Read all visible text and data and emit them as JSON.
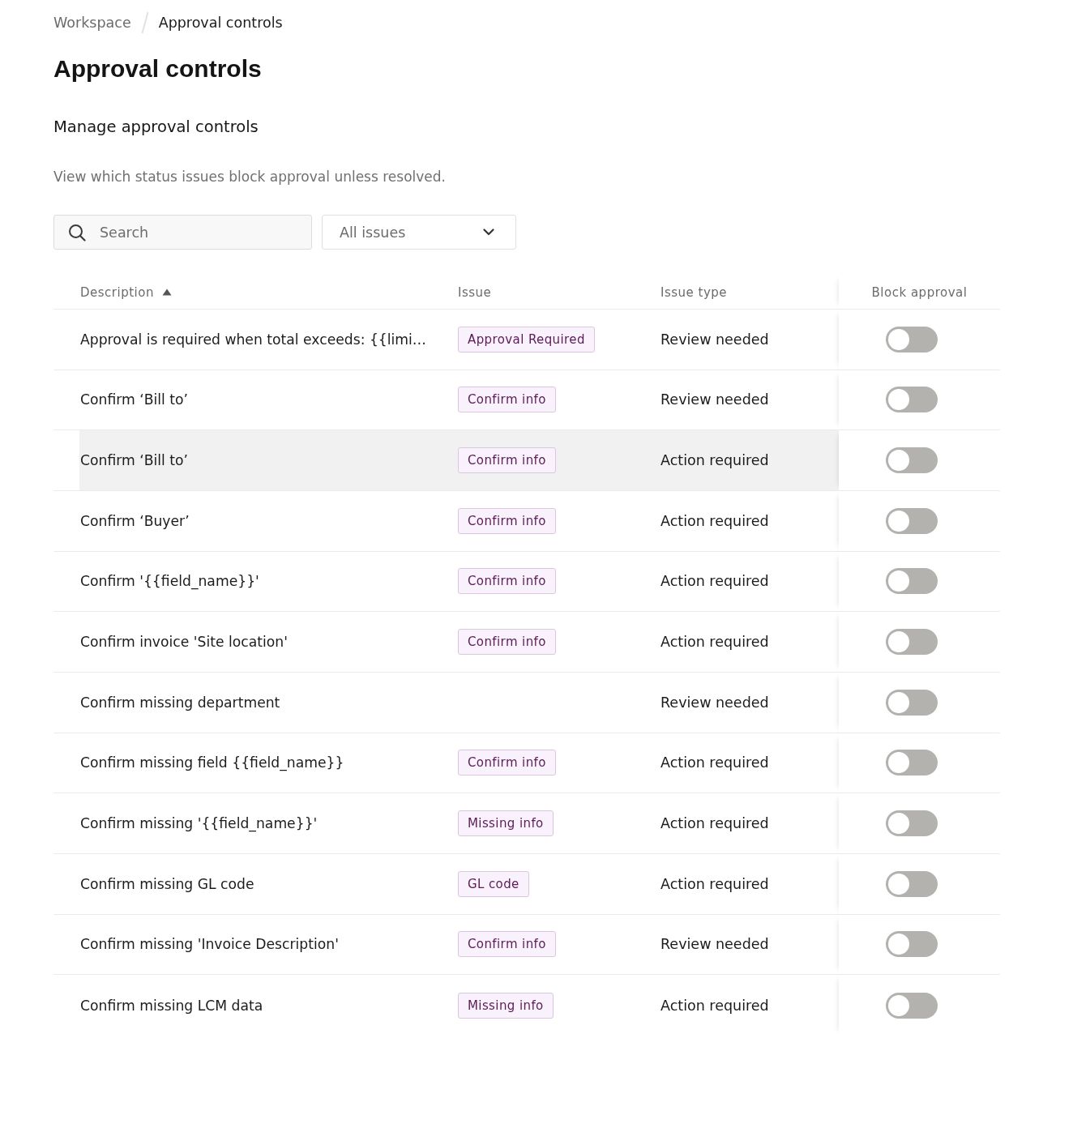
{
  "breadcrumb": [
    {
      "label": "Workspace",
      "current": false
    },
    {
      "label": "Approval controls",
      "current": true
    }
  ],
  "page_title": "Approval controls",
  "section": {
    "title": "Manage approval controls",
    "description": "View which status issues block approval unless resolved."
  },
  "filters": {
    "search": {
      "placeholder": "Search"
    },
    "issue_filter": {
      "value": "All issues"
    }
  },
  "table": {
    "columns": [
      {
        "label": "Description",
        "sorted": true
      },
      {
        "label": "Issue",
        "sorted": false
      },
      {
        "label": "Issue type",
        "sorted": false
      },
      {
        "label": "Block approval",
        "sorted": false
      }
    ],
    "rows": [
      {
        "description": "Approval is required when total exceeds: {{limi…",
        "issue": "Approval Required",
        "issue_type": "Review needed",
        "block_approval": false,
        "highlighted": false
      },
      {
        "description": "Confirm ‘Bill to’",
        "issue": "Confirm info",
        "issue_type": "Review needed",
        "block_approval": false,
        "highlighted": false
      },
      {
        "description": "Confirm ‘Bill to’",
        "issue": "Confirm info",
        "issue_type": "Action required",
        "block_approval": false,
        "highlighted": true
      },
      {
        "description": "Confirm ‘Buyer’",
        "issue": "Confirm info",
        "issue_type": "Action required",
        "block_approval": false,
        "highlighted": false
      },
      {
        "description": "Confirm '{{field_name}}'",
        "issue": "Confirm info",
        "issue_type": "Action required",
        "block_approval": false,
        "highlighted": false
      },
      {
        "description": "Confirm invoice 'Site location'",
        "issue": "Confirm info",
        "issue_type": "Action required",
        "block_approval": false,
        "highlighted": false
      },
      {
        "description": "Confirm missing department",
        "issue_type": "Review needed",
        "block_approval": false,
        "highlighted": false
      },
      {
        "description": "Confirm missing field {{field_name}}",
        "issue": "Confirm info",
        "issue_type": "Action required",
        "block_approval": false,
        "highlighted": false
      },
      {
        "description": "Confirm missing '{{field_name}}'",
        "issue": "Missing info",
        "issue_type": "Action required",
        "block_approval": false,
        "highlighted": false
      },
      {
        "description": "Confirm missing GL code",
        "issue": "GL code",
        "issue_type": "Action required",
        "block_approval": false,
        "highlighted": false
      },
      {
        "description": "Confirm missing 'Invoice Description'",
        "issue": "Confirm info",
        "issue_type": "Review needed",
        "block_approval": false,
        "highlighted": false
      },
      {
        "description": "Confirm missing LCM data",
        "issue": "Missing info",
        "issue_type": "Action required",
        "block_approval": false,
        "highlighted": false
      }
    ]
  }
}
